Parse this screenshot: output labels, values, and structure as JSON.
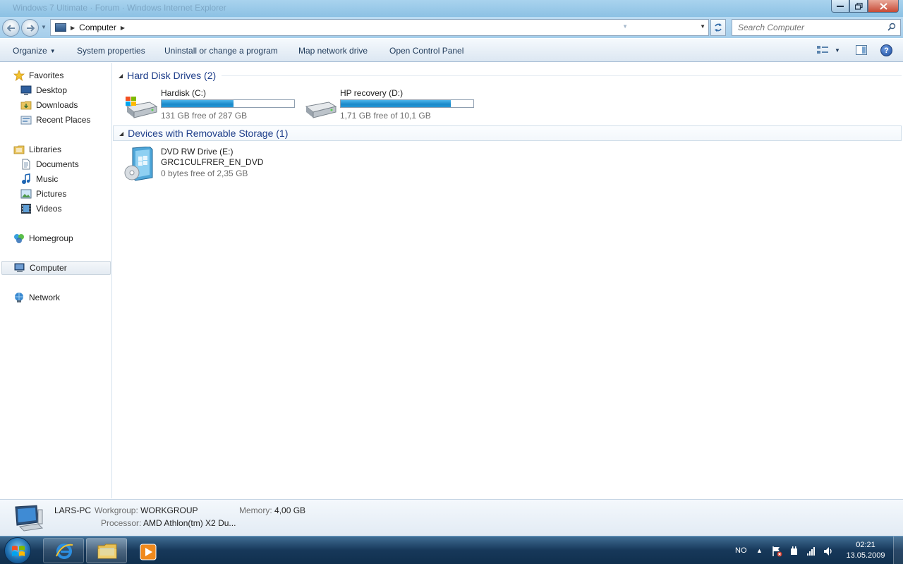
{
  "window": {
    "title": "Windows 7 Ultimate · Forum · Windows Internet Explorer"
  },
  "address": {
    "location": "Computer",
    "search_placeholder": "Search Computer"
  },
  "toolbar": {
    "organize": "Organize",
    "system_properties": "System properties",
    "uninstall": "Uninstall or change a program",
    "map_drive": "Map network drive",
    "control_panel": "Open Control Panel"
  },
  "nav": {
    "favorites": "Favorites",
    "desktop": "Desktop",
    "downloads": "Downloads",
    "recent": "Recent Places",
    "libraries": "Libraries",
    "documents": "Documents",
    "music": "Music",
    "pictures": "Pictures",
    "videos": "Videos",
    "homegroup": "Homegroup",
    "computer": "Computer",
    "network": "Network"
  },
  "groups": {
    "hdd": "Hard Disk Drives (2)",
    "removable": "Devices with Removable Storage (1)"
  },
  "drives": [
    {
      "name": "Hardisk (C:)",
      "free": "131 GB free of 287 GB",
      "used_fraction": 0.54
    },
    {
      "name": "HP recovery (D:)",
      "free": "1,71 GB free of 10,1 GB",
      "used_fraction": 0.83
    }
  ],
  "dvd": {
    "name": "DVD RW Drive (E:)",
    "label": "GRC1CULFRER_EN_DVD",
    "free": "0 bytes free of 2,35 GB"
  },
  "details": {
    "pc_name": "LARS-PC",
    "workgroup_label": "Workgroup:",
    "workgroup": "WORKGROUP",
    "memory_label": "Memory:",
    "memory": "4,00 GB",
    "processor_label": "Processor:",
    "processor": "AMD Athlon(tm) X2 Du..."
  },
  "taskbar": {
    "language": "NO",
    "time": "02:21",
    "date": "13.05.2009"
  }
}
